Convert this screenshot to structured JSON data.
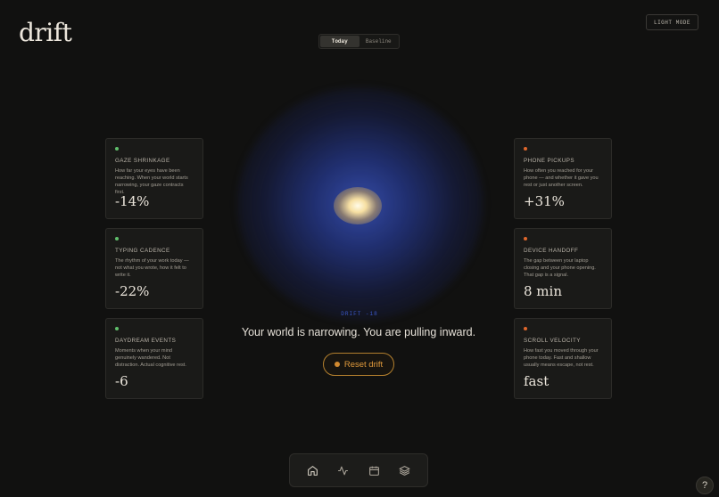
{
  "app": {
    "logo": "drift",
    "mode_button": "LIGHT MODE"
  },
  "segment": {
    "tabs": [
      "Today",
      "Baseline"
    ],
    "active": "Today"
  },
  "orb": {
    "drift_label": "DRIFT -18",
    "headline": "Your world is narrowing. You are pulling inward.",
    "reset_label": "Reset drift"
  },
  "colors": {
    "accent_amber": "#d28a30",
    "accent_blue": "#3b58c8",
    "good_green": "#5fbf6b",
    "warn_orange": "#e0672c"
  },
  "left_cards": [
    {
      "title": "GAZE SHRINKAGE",
      "desc": "How far your eyes have been reaching. When your world starts narrowing, your gaze contracts first.",
      "value": "-14%",
      "status": "green"
    },
    {
      "title": "TYPING CADENCE",
      "desc": "The rhythm of your work today — not what you wrote, how it felt to write it.",
      "value": "-22%",
      "status": "green"
    },
    {
      "title": "DAYDREAM EVENTS",
      "desc": "Moments when your mind genuinely wandered. Not distraction. Actual cognitive rest.",
      "value": "-6",
      "status": "green"
    }
  ],
  "right_cards": [
    {
      "title": "PHONE PICKUPS",
      "desc": "How often you reached for your phone — and whether it gave you rest or just another screen.",
      "value": "+31%",
      "status": "orange"
    },
    {
      "title": "DEVICE HANDOFF",
      "desc": "The gap between your laptop closing and your phone opening. That gap is a signal.",
      "value": "8 min",
      "status": "orange"
    },
    {
      "title": "SCROLL VELOCITY",
      "desc": "How fast you moved through your phone today. Fast and shallow usually means escape, not rest.",
      "value": "fast",
      "status": "orange"
    }
  ],
  "nav": {
    "items": [
      "home-icon",
      "activity-icon",
      "calendar-icon",
      "layers-icon"
    ]
  },
  "help": {
    "label": "?"
  }
}
